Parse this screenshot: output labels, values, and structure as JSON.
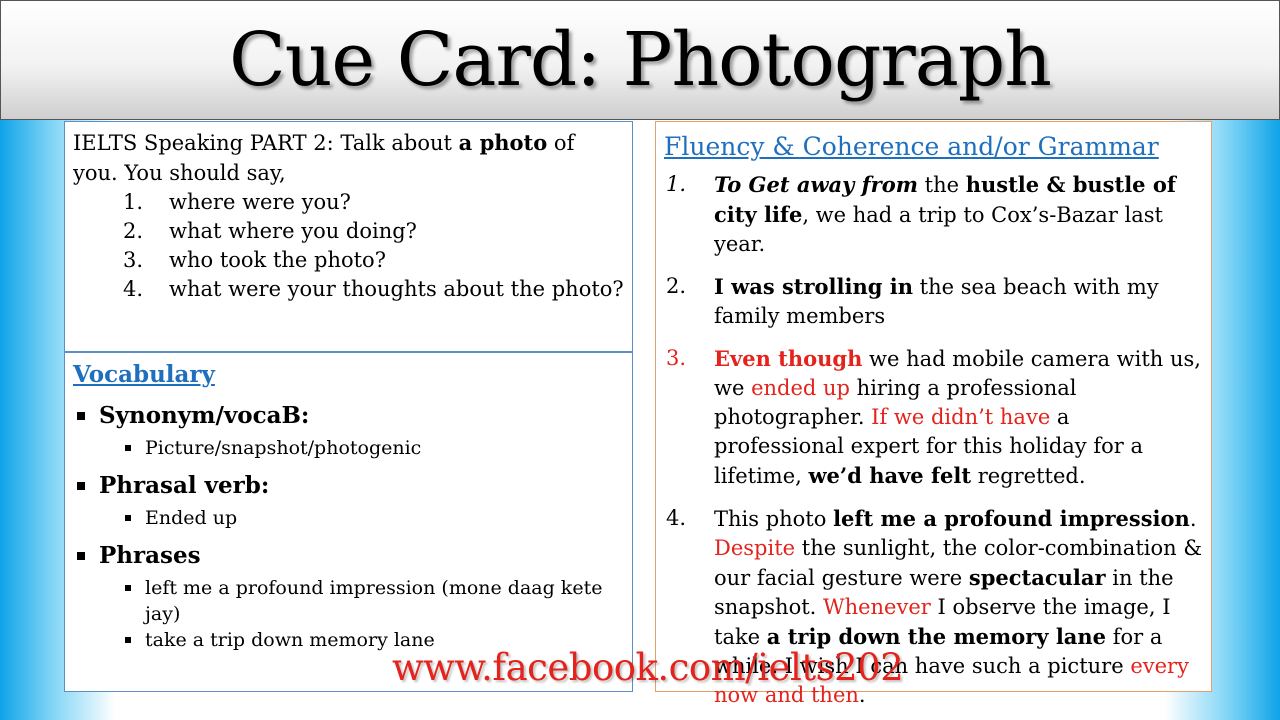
{
  "title": "Cue Card: Photograph",
  "task": {
    "intro_1": "IELTS Speaking PART 2: Talk about ",
    "intro_bold": "a photo",
    "intro_2": " of you. You should say,",
    "items": [
      {
        "num": "1.",
        "text": "where were you?"
      },
      {
        "num": "2.",
        "text": "what where you doing?"
      },
      {
        "num": "3.",
        "text": "who took the photo?"
      },
      {
        "num": "4.",
        "text": "what were your thoughts about the photo?"
      }
    ]
  },
  "vocabulary": {
    "heading": "Vocabulary",
    "groups": [
      {
        "head": "Synonym/vocaB:",
        "items": [
          "Picture/snapshot/photogenic"
        ]
      },
      {
        "head": "Phrasal verb:",
        "items": [
          "Ended up"
        ]
      },
      {
        "head": "Phrases",
        "items": [
          "left me a profound impression (mone daag kete jay)",
          "take a trip down memory lane"
        ]
      }
    ]
  },
  "fluency": {
    "heading": "Fluency & Coherence and/or Grammar",
    "item1": {
      "num": "1.",
      "a": "To Get away from",
      "b": " the ",
      "c": "hustle & bustle of city life",
      "d": ", we had a trip to Cox’s-Bazar last year."
    },
    "item2": {
      "num": "2.",
      "a": "I was strolling in",
      "b": " the sea beach with my family members"
    },
    "item3": {
      "num": "3.",
      "a": "Even though",
      "b": " we had mobile camera with us, we ",
      "c": "ended up",
      "d": " hiring a professional photographer. ",
      "e": "If we didn’t have",
      "f": " a professional expert for this holiday for a lifetime, ",
      "g": "we’d have felt",
      "h": " regretted."
    },
    "item4": {
      "num": "4.",
      "a": "This photo ",
      "b": "left me a profound impression",
      "c": ". ",
      "d": "Despite",
      "e": " the sunlight, the color-combination & our facial gesture were ",
      "f": "spectacular",
      "g": " in the snapshot. ",
      "h": "Whenever",
      "i": " I observe the image, I take ",
      "j": "a trip down the memory lane",
      "k": " for a while. I wish I can have such a picture ",
      "l": "every now and then",
      "m": "."
    }
  },
  "footer": "www.facebook.com/ielts202",
  "colors": {
    "heading_blue": "#1f6fbf",
    "accent_red": "#e3231c",
    "side_gradient": "#0fa3e8"
  }
}
